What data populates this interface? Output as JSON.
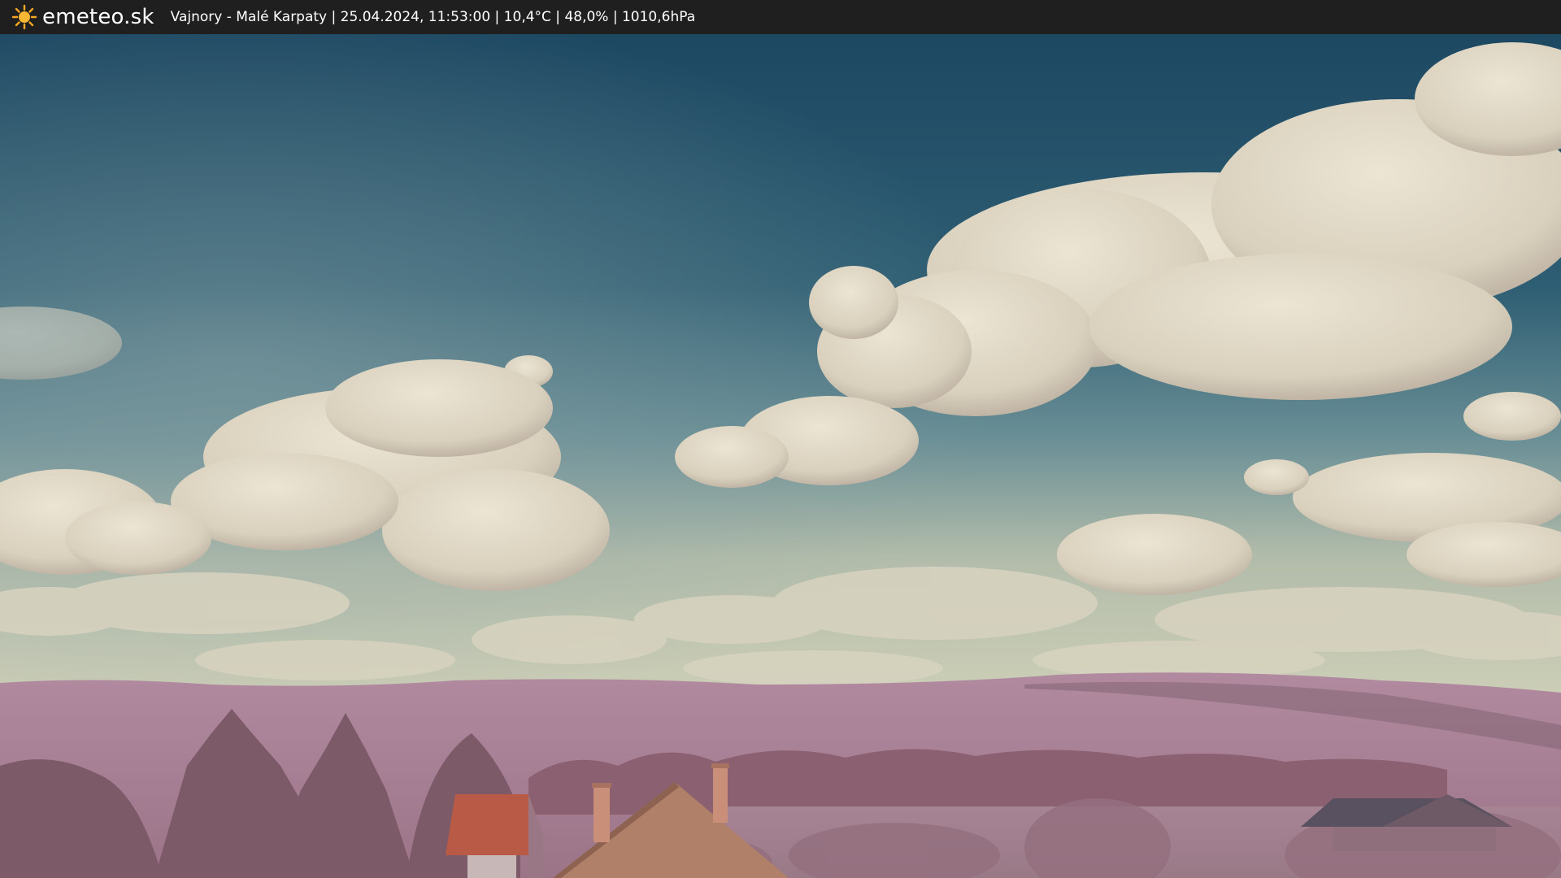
{
  "header": {
    "logo_text": "emeteo.sk",
    "logo_icon": "sun-icon",
    "caption": "Vajnory - Malé Karpaty | 25.04.2024, 11:53:00 | 10,4°C | 48,0% | 1010,6hPa"
  },
  "colors": {
    "bar": "#1f1f1f",
    "sun": "#f5a623",
    "sky_top": "#1f4a63",
    "sky_mid": "#4d7e8f",
    "horizon": "#c8ccb4",
    "cloud": "#e2dccb",
    "hills": "#a97f98",
    "foliage": "#8c6472"
  }
}
